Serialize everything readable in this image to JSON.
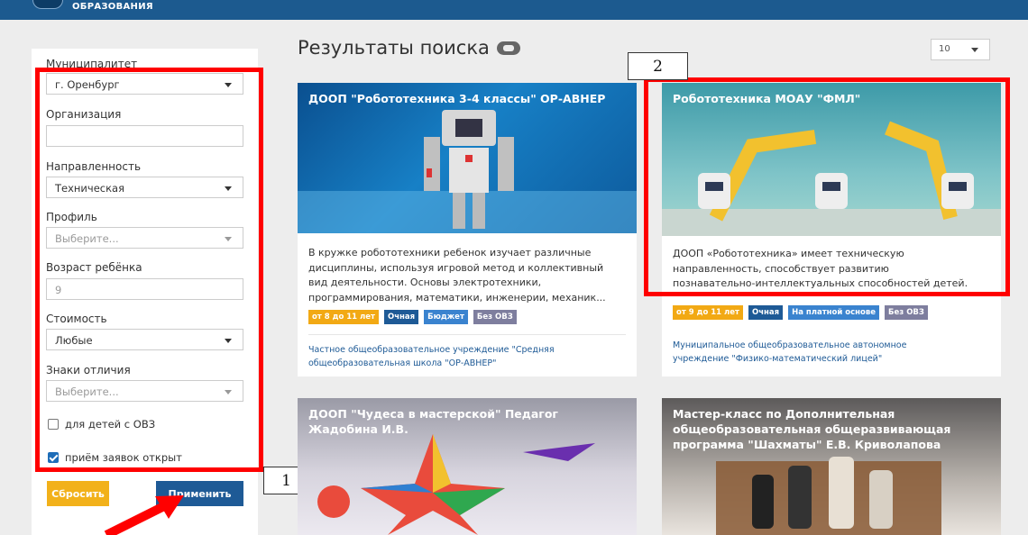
{
  "header": {
    "brand": "ОБРАЗОВАНИЯ"
  },
  "filters": {
    "municipality": {
      "label": "Муниципалитет",
      "value": "г. Оренбург"
    },
    "organization": {
      "label": "Организация",
      "value": ""
    },
    "direction": {
      "label": "Направленность",
      "value": "Техническая"
    },
    "profile": {
      "label": "Профиль",
      "placeholder": "Выберите..."
    },
    "age": {
      "label": "Возраст ребёнка",
      "value": "9"
    },
    "cost": {
      "label": "Стоимость",
      "value": "Любые"
    },
    "badges": {
      "label": "Знаки отличия",
      "placeholder": "Выберите..."
    },
    "ovz": {
      "label": "для детей с ОВЗ",
      "checked": false
    },
    "open": {
      "label": "приём заявок открыт",
      "checked": true
    },
    "reset_label": "Сбросить",
    "apply_label": "Применить"
  },
  "results": {
    "heading": "Результаты поиска",
    "per_page": "10",
    "cards": [
      {
        "title": "ДООП \"Робототехника 3-4 классы\" ОР-АВНЕР",
        "desc_lines": [
          "В кружке робототехники ребенок изучает различные",
          "дисциплины, используя игровой метод и коллективный",
          "вид деятельности. Основы электротехники,",
          "программирования, математики, инженерии, механик..."
        ],
        "tags": [
          "от 8 до 11 лет",
          "Очная",
          "Бюджет",
          "Без ОВЗ"
        ],
        "org_lines": [
          "Частное общеобразовательное учреждение \"Средняя",
          "общеобразовательная школа \"ОР-АВНЕР\""
        ]
      },
      {
        "title": "Робототехника МОАУ \"ФМЛ\"",
        "desc_lines": [
          "ДООП «Робототехника» имеет техническую",
          "направленность, способствует развитию",
          "познавательно-интеллектуальных способностей детей."
        ],
        "tags": [
          "от 9 до 11 лет",
          "Очная",
          "На платной основе",
          "Без ОВЗ"
        ],
        "org_lines": [
          "Муниципальное общеобразовательное автономное",
          "учреждение \"Физико-математический лицей\""
        ]
      },
      {
        "title_lines": [
          "ДООП \"Чудеса в мастерской\" Педагог",
          "Жадобина И.В."
        ]
      },
      {
        "title_lines": [
          "Мастер-класс по Дополнительная",
          "общеобразовательная общеразвивающая",
          "программа \"Шахматы\" Е.В. Криволапова"
        ]
      }
    ]
  },
  "annotations": {
    "label_1": "1",
    "label_2": "2"
  },
  "colors": {
    "header": "#1c5a8f",
    "highlight": "#ff0000",
    "reset": "#f2b11a",
    "apply": "#1e5a96"
  }
}
